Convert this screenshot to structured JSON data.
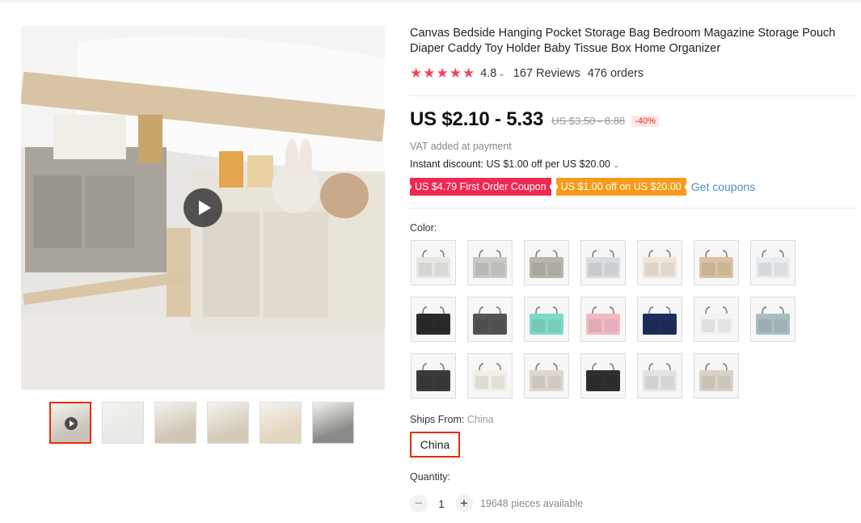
{
  "product": {
    "title": "Canvas Bedside Hanging Pocket Storage Bag Bedroom Magazine Storage Pouch Diaper Caddy Toy Holder Baby Tissue Box Home Organizer",
    "rating": {
      "stars": "★★★★★",
      "score": "4.8",
      "reviews": "167 Reviews",
      "orders": "476 orders"
    },
    "price": "US $2.10 - 5.33",
    "old_price": "US $3.50 - 8.88",
    "discount": "-40%",
    "vat": "VAT added at payment",
    "instant_discount": "Instant discount: US $1.00 off per US $20.00",
    "coupons": [
      "US $4.79 First Order Coupon",
      "US $1.00 off on US $20.00"
    ],
    "get_coupons": "Get coupons",
    "color_label": "Color:",
    "ships_from_label": "Ships From:",
    "ships_from_value": "China",
    "ships_option": "China",
    "quantity_label": "Quantity:",
    "quantity_value": "1",
    "available": "19648 pieces available",
    "accent_color": "#e62e04"
  },
  "color_swatches": [
    {
      "name": "light-grey-hanging-bag",
      "color": "#e7e6e2"
    },
    {
      "name": "grey-hanging-bag",
      "color": "#c9c8c4"
    },
    {
      "name": "grey-bag-on-bed",
      "color": "#b8b5ad"
    },
    {
      "name": "triangle-print-bag",
      "color": "#d9dde0"
    },
    {
      "name": "cream-bag-with-toys",
      "color": "#efe6d9"
    },
    {
      "name": "khaki-flat-bag",
      "color": "#d9c2a2"
    },
    {
      "name": "plaid-bag",
      "color": "#e9ecef"
    },
    {
      "name": "black-plaid-bag",
      "color": "#2b2b2b"
    },
    {
      "name": "black-white-plaid-bag",
      "color": "#555555"
    },
    {
      "name": "mint-bag",
      "color": "#7fd9c4"
    },
    {
      "name": "pink-bag",
      "color": "#f2b9c3"
    },
    {
      "name": "navy-bag",
      "color": "#1f2d5c"
    },
    {
      "name": "white-grid-bag",
      "color": "#f3f3f3"
    },
    {
      "name": "blue-grey-bag",
      "color": "#a9bcc2"
    },
    {
      "name": "black-white-print-bag",
      "color": "#3a3a3a"
    },
    {
      "name": "cactus-print-bag",
      "color": "#f2efe6"
    },
    {
      "name": "floral-bag",
      "color": "#ddd7cf"
    },
    {
      "name": "black-patterned-bag",
      "color": "#2f2f2f"
    },
    {
      "name": "leaf-print-bag",
      "color": "#e3e3e3"
    },
    {
      "name": "bird-print-bag",
      "color": "#d8d2c6"
    }
  ],
  "gallery_thumbs": [
    {
      "name": "video-thumbnail",
      "color": "#c9c3b8"
    },
    {
      "name": "grey-bag-thumbnail",
      "color": "#e8e8e6"
    },
    {
      "name": "bed-thumbnail",
      "color": "#cfc6b6"
    },
    {
      "name": "cream-bag-thumbnail",
      "color": "#d4cab8"
    },
    {
      "name": "toys-bag-thumbnail",
      "color": "#e3d6bf"
    },
    {
      "name": "grey-wall-thumbnail",
      "color": "#8c8a88"
    }
  ]
}
